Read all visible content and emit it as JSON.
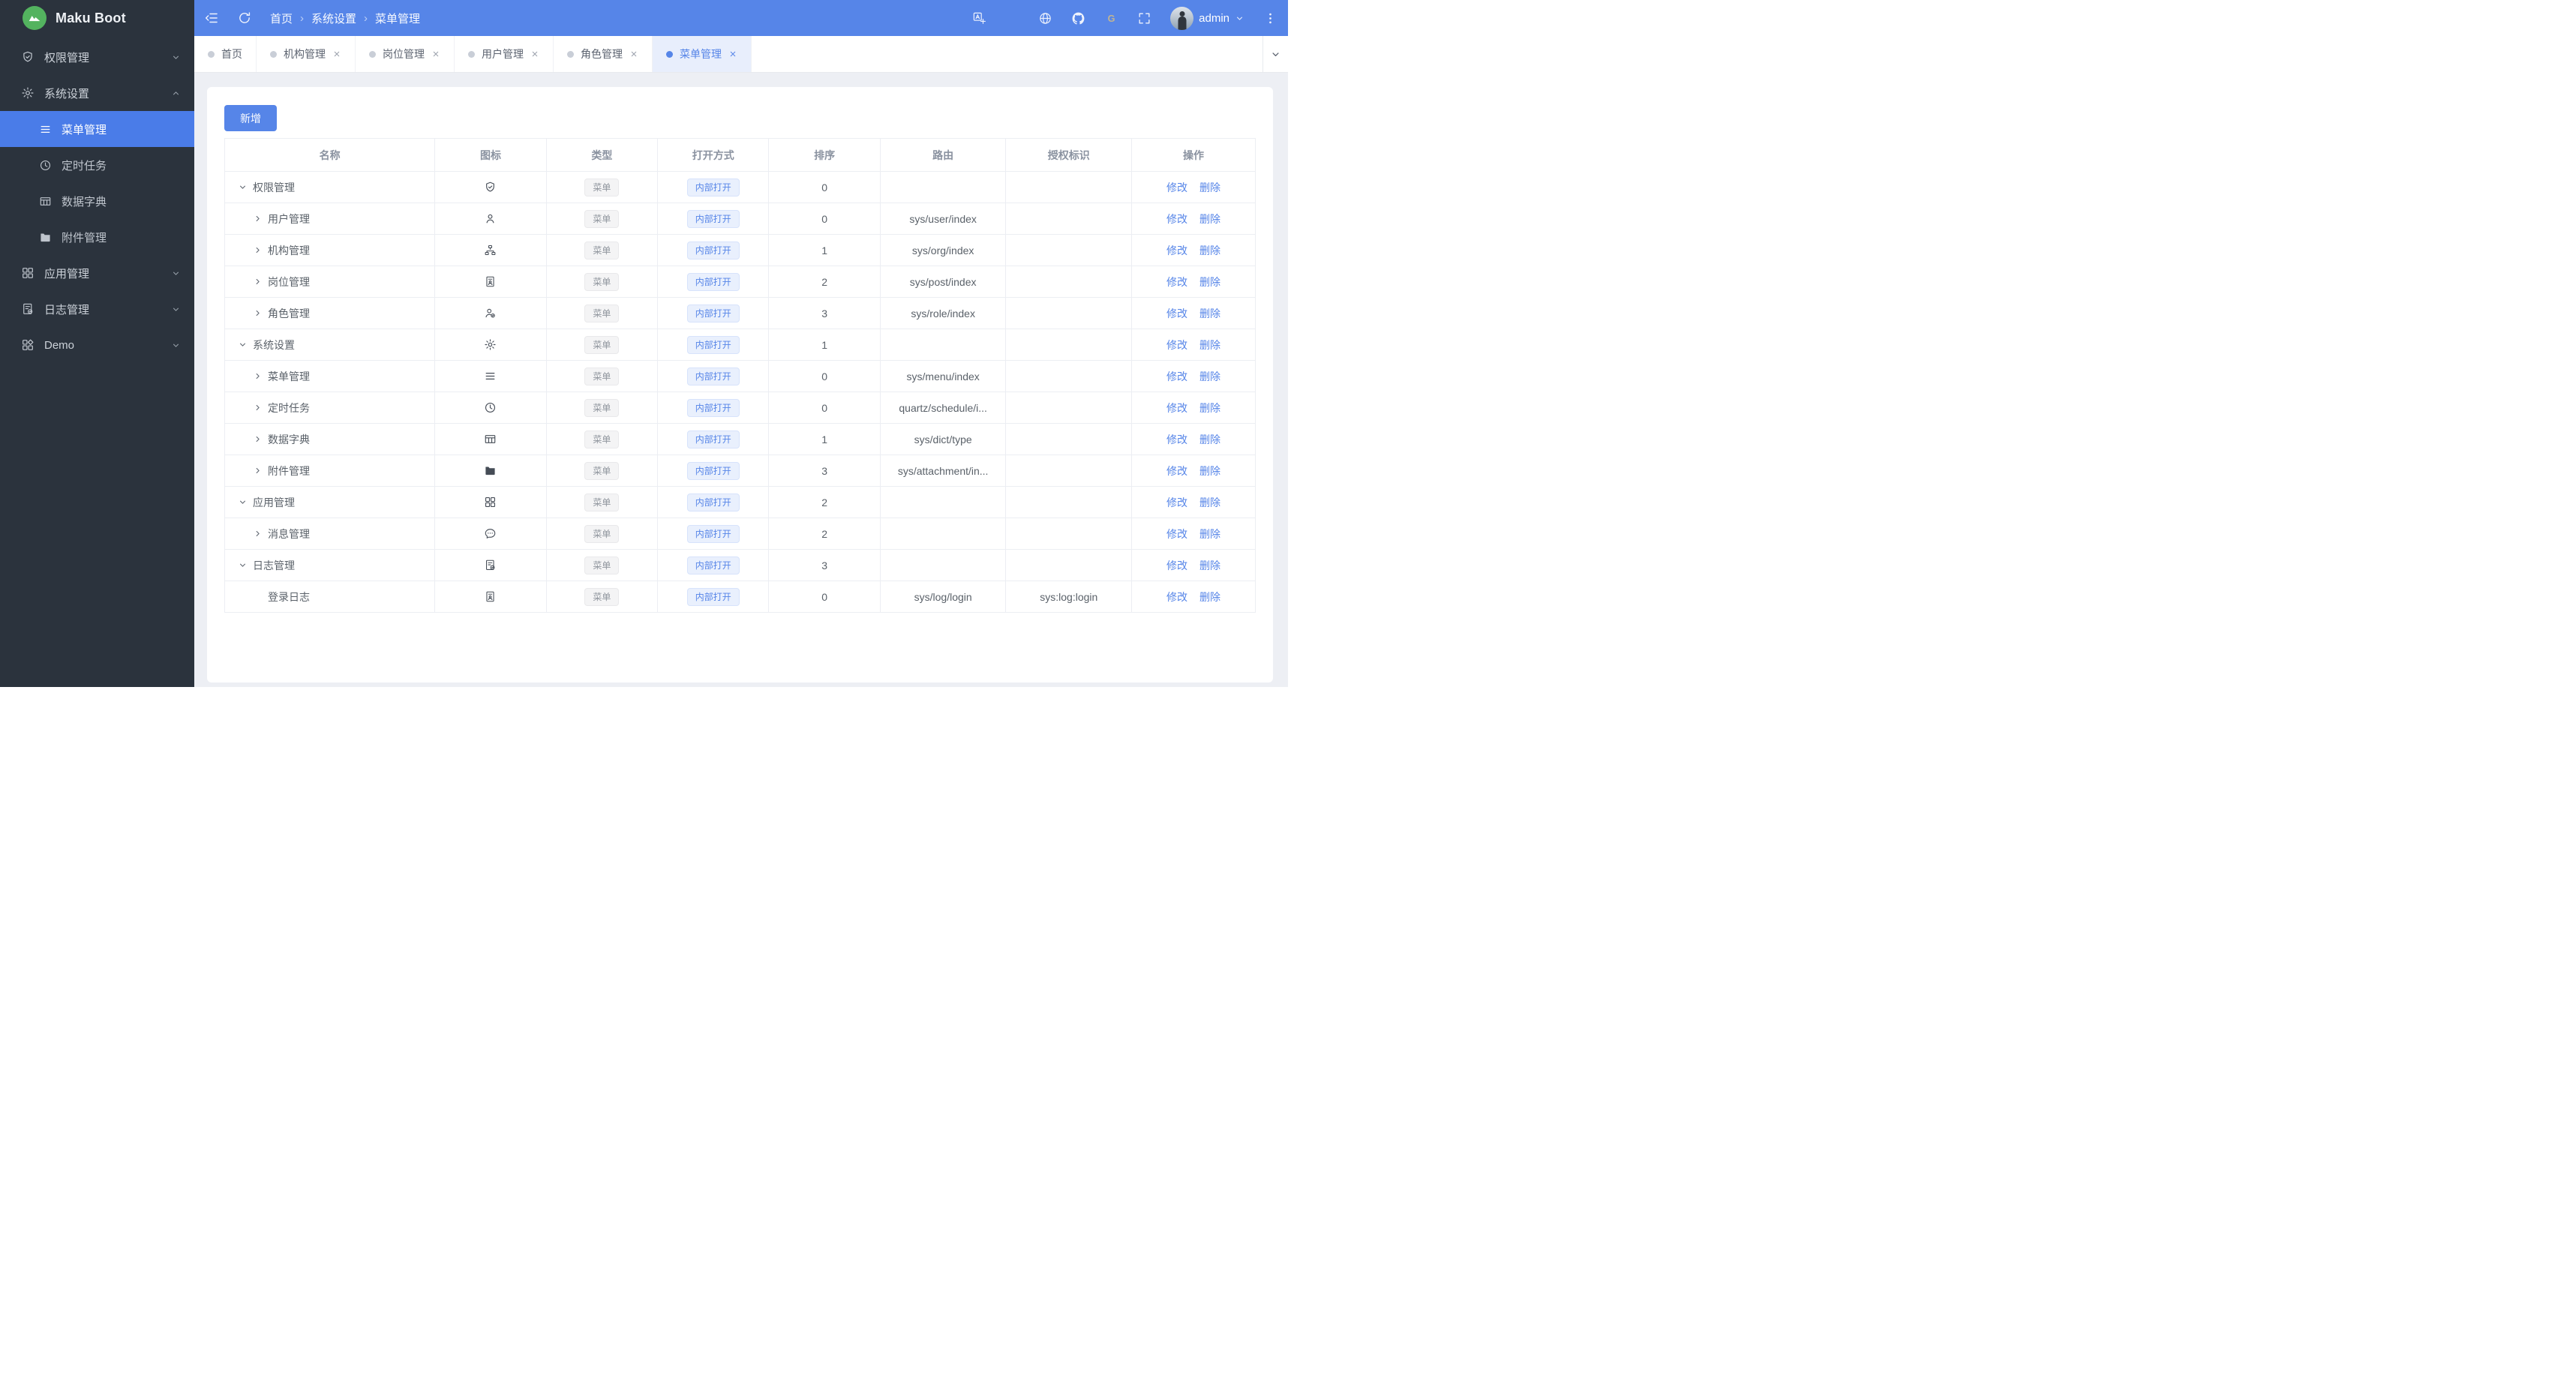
{
  "app": {
    "name": "Maku Boot"
  },
  "topbar": {
    "breadcrumb": [
      "首页",
      "系统设置",
      "菜单管理"
    ],
    "separator": "›",
    "username": "admin",
    "actions": [
      "translate",
      "font-size",
      "globe",
      "github",
      "gitee",
      "fullscreen"
    ]
  },
  "tabs": [
    {
      "key": "home",
      "label": "首页",
      "closable": false,
      "active": false
    },
    {
      "key": "org-mgmt",
      "label": "机构管理",
      "closable": true,
      "active": false
    },
    {
      "key": "post-mgmt",
      "label": "岗位管理",
      "closable": true,
      "active": false
    },
    {
      "key": "user-mgmt",
      "label": "用户管理",
      "closable": true,
      "active": false
    },
    {
      "key": "role-mgmt",
      "label": "角色管理",
      "closable": true,
      "active": false
    },
    {
      "key": "menu-mgmt",
      "label": "菜单管理",
      "closable": true,
      "active": true
    }
  ],
  "sidebar": [
    {
      "key": "permission",
      "label": "权限管理",
      "icon": "shield",
      "state": "collapsed"
    },
    {
      "key": "system",
      "label": "系统设置",
      "icon": "gear",
      "state": "expanded",
      "children": [
        {
          "key": "menu",
          "label": "菜单管理",
          "icon": "menu",
          "active": true
        },
        {
          "key": "schedule",
          "label": "定时任务",
          "icon": "clock",
          "active": false
        },
        {
          "key": "dict",
          "label": "数据字典",
          "icon": "dict",
          "active": false
        },
        {
          "key": "attachment",
          "label": "附件管理",
          "icon": "folder",
          "active": false
        }
      ]
    },
    {
      "key": "app",
      "label": "应用管理",
      "icon": "grid",
      "state": "collapsed"
    },
    {
      "key": "log",
      "label": "日志管理",
      "icon": "log",
      "state": "collapsed"
    },
    {
      "key": "demo",
      "label": "Demo",
      "icon": "grid2",
      "state": "collapsed"
    }
  ],
  "toolbar": {
    "add_label": "新增"
  },
  "table": {
    "columns": [
      "名称",
      "图标",
      "类型",
      "打开方式",
      "排序",
      "路由",
      "授权标识",
      "操作"
    ],
    "ops": {
      "edit": "修改",
      "delete": "删除"
    },
    "rows": [
      {
        "key": "permission",
        "name": "权限管理",
        "icon": "shield",
        "arrow": "down",
        "level": 0,
        "type": "菜单",
        "open": "内部打开",
        "sort": "0",
        "route": "",
        "auth": ""
      },
      {
        "key": "user",
        "name": "用户管理",
        "icon": "user",
        "arrow": "right",
        "level": 1,
        "type": "菜单",
        "open": "内部打开",
        "sort": "0",
        "route": "sys/user/index",
        "auth": ""
      },
      {
        "key": "org",
        "name": "机构管理",
        "icon": "org",
        "arrow": "right",
        "level": 1,
        "type": "菜单",
        "open": "内部打开",
        "sort": "1",
        "route": "sys/org/index",
        "auth": ""
      },
      {
        "key": "post",
        "name": "岗位管理",
        "icon": "post",
        "arrow": "right",
        "level": 1,
        "type": "菜单",
        "open": "内部打开",
        "sort": "2",
        "route": "sys/post/index",
        "auth": ""
      },
      {
        "key": "role",
        "name": "角色管理",
        "icon": "role",
        "arrow": "right",
        "level": 1,
        "type": "菜单",
        "open": "内部打开",
        "sort": "3",
        "route": "sys/role/index",
        "auth": ""
      },
      {
        "key": "system",
        "name": "系统设置",
        "icon": "gear",
        "arrow": "down",
        "level": 0,
        "type": "菜单",
        "open": "内部打开",
        "sort": "1",
        "route": "",
        "auth": ""
      },
      {
        "key": "menu",
        "name": "菜单管理",
        "icon": "menu",
        "arrow": "right",
        "level": 1,
        "type": "菜单",
        "open": "内部打开",
        "sort": "0",
        "route": "sys/menu/index",
        "auth": ""
      },
      {
        "key": "schedule",
        "name": "定时任务",
        "icon": "clock",
        "arrow": "right",
        "level": 1,
        "type": "菜单",
        "open": "内部打开",
        "sort": "0",
        "route": "quartz/schedule/i...",
        "auth": ""
      },
      {
        "key": "dict",
        "name": "数据字典",
        "icon": "dict",
        "arrow": "right",
        "level": 1,
        "type": "菜单",
        "open": "内部打开",
        "sort": "1",
        "route": "sys/dict/type",
        "auth": ""
      },
      {
        "key": "attachment",
        "name": "附件管理",
        "icon": "folder",
        "arrow": "right",
        "level": 1,
        "type": "菜单",
        "open": "内部打开",
        "sort": "3",
        "route": "sys/attachment/in...",
        "auth": ""
      },
      {
        "key": "app",
        "name": "应用管理",
        "icon": "grid",
        "arrow": "down",
        "level": 0,
        "type": "菜单",
        "open": "内部打开",
        "sort": "2",
        "route": "",
        "auth": ""
      },
      {
        "key": "message",
        "name": "消息管理",
        "icon": "message",
        "arrow": "right",
        "level": 1,
        "type": "菜单",
        "open": "内部打开",
        "sort": "2",
        "route": "",
        "auth": ""
      },
      {
        "key": "log",
        "name": "日志管理",
        "icon": "log",
        "arrow": "down",
        "level": 0,
        "type": "菜单",
        "open": "内部打开",
        "sort": "3",
        "route": "",
        "auth": ""
      },
      {
        "key": "login-log",
        "name": "登录日志",
        "icon": "login",
        "arrow": "none",
        "level": 1,
        "type": "菜单",
        "open": "内部打开",
        "sort": "0",
        "route": "sys/log/login",
        "auth": "sys:log:login"
      }
    ]
  },
  "colors": {
    "primary": "#5685e8",
    "sidebar_bg": "#2b333d",
    "active_menu_bg": "#4a7ce8",
    "logo_green": "#53b35f",
    "content_bg": "#edeff4",
    "tag_info_text": "#90969e",
    "tag_primary_text": "#5685e8",
    "gitee_icon": "#c0b494"
  }
}
